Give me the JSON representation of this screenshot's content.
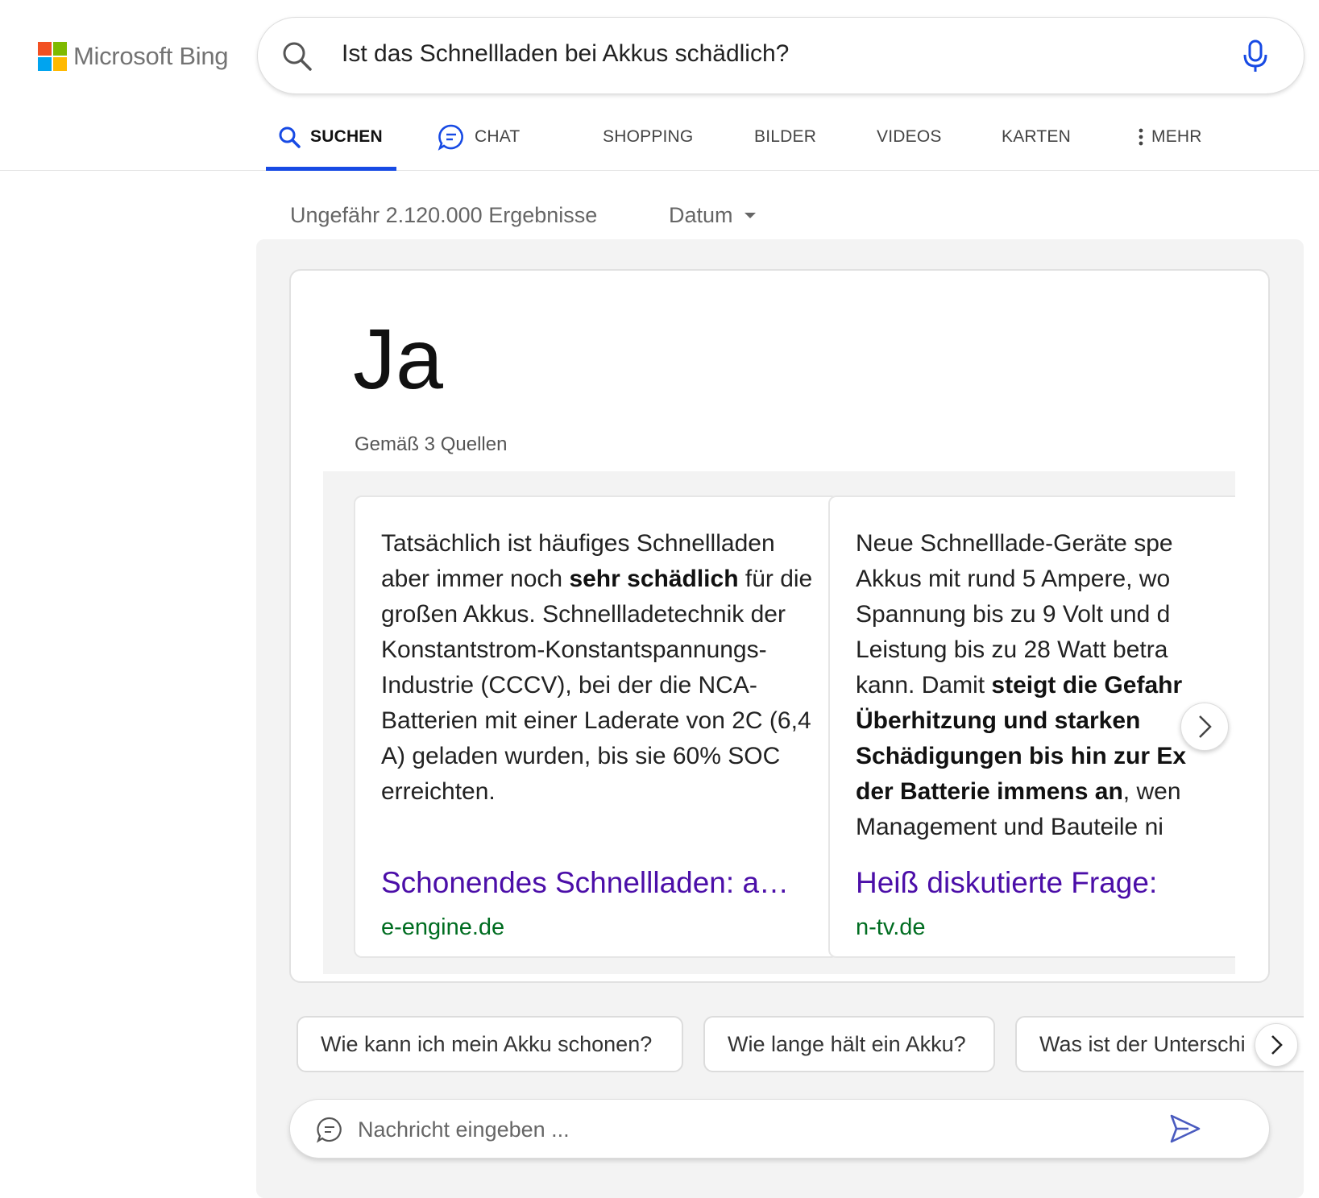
{
  "brand": {
    "name": "Microsoft Bing",
    "colors": [
      "#f25022",
      "#7fba00",
      "#00a4ef",
      "#ffb900"
    ]
  },
  "search": {
    "query": "Ist das Schnellladen bei Akkus schädlich?",
    "icon": "search-icon",
    "mic_icon": "microphone-icon"
  },
  "tabs": [
    {
      "label": "SUCHEN",
      "icon": "search-icon",
      "active": true
    },
    {
      "label": "CHAT",
      "icon": "chat-bubble-icon",
      "active": false
    },
    {
      "label": "SHOPPING",
      "active": false
    },
    {
      "label": "BILDER",
      "active": false
    },
    {
      "label": "VIDEOS",
      "active": false
    },
    {
      "label": "KARTEN",
      "active": false
    },
    {
      "label": "MEHR",
      "icon": "more-vertical-icon",
      "active": false
    }
  ],
  "results_meta": {
    "count": "Ungefähr 2.120.000 Ergebnisse",
    "date_filter": "Datum"
  },
  "answer": {
    "title": "Ja",
    "sources_label": "Gemäß 3 Quellen",
    "cards": [
      {
        "snippet_parts": [
          "Tatsächlich ist häufiges Schnellladen aber immer noch ",
          "sehr schädlich",
          " für die großen Akkus. Schnellladetechnik der Konstantstrom-Konstantspannungs-Industrie (CCCV), bei der die NCA-Batterien mit einer Laderate von 2C (6,4 A) geladen wurden, bis sie 60% SOC erreichten."
        ],
        "title": "Schonendes Schnellladen: a…",
        "domain": "e-engine.de"
      },
      {
        "snippet_lines": [
          "Neue Schnelllade-Geräte spe",
          "Akkus mit rund 5 Ampere, wo",
          "Spannung bis zu 9 Volt und d",
          "Leistung bis zu 28 Watt betra",
          "kann. Damit ",
          "steigt die Gefahr",
          "Überhitzung und starken",
          "Schädigungen bis hin zur Ex",
          "der Batterie immens an",
          ", wen",
          "Management und Bauteile ni"
        ],
        "title": "Heiß diskutierte Frage:",
        "domain": "n-tv.de"
      }
    ],
    "next_icon": "chevron-right-icon"
  },
  "suggestions": [
    "Wie kann ich mein Akku schonen?",
    "Wie lange hält ein Akku?",
    "Was ist der Unterschi"
  ],
  "chat_input": {
    "placeholder": "Nachricht eingeben ...",
    "icon": "chat-bubble-icon",
    "send_icon": "send-icon"
  },
  "colors": {
    "accent": "#174ae4",
    "link_title": "#4b0ea8",
    "link_domain": "#006d21",
    "send": "#4a5bbf"
  }
}
